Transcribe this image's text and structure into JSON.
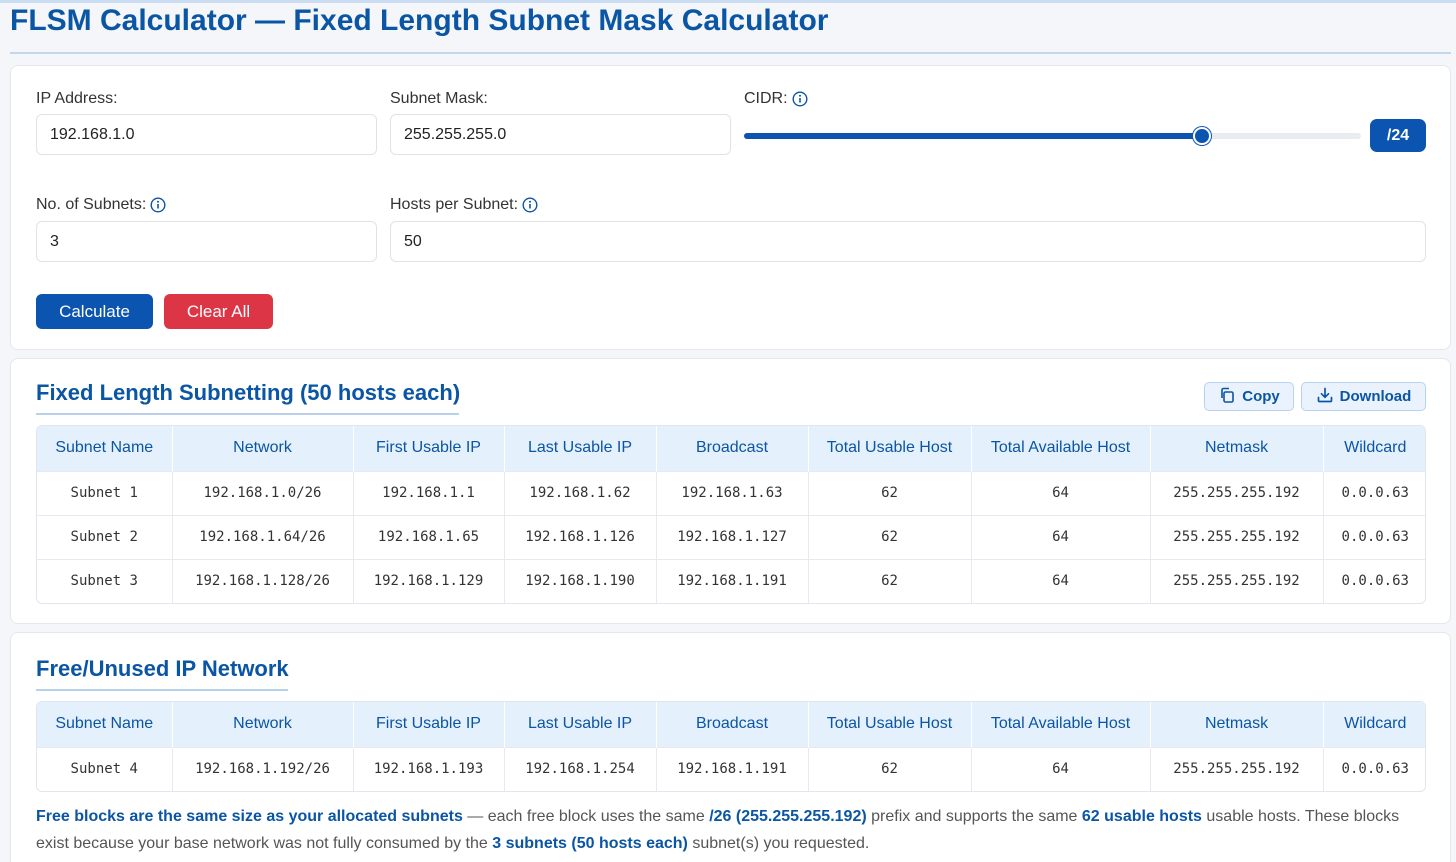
{
  "title": "FLSM Calculator — Fixed Length Subnet Mask Calculator",
  "form": {
    "ip_label": "IP Address:",
    "ip_value": "192.168.1.0",
    "mask_label": "Subnet Mask:",
    "mask_value": "255.255.255.0",
    "cidr_label": "CIDR:",
    "cidr_value": 24,
    "cidr_min": 0,
    "cidr_max": 32,
    "cidr_badge": "/24",
    "subnets_label": "No. of Subnets:",
    "subnets_value": "3",
    "hosts_label": "Hosts per Subnet:",
    "hosts_value": "50",
    "calculate_label": "Calculate",
    "clear_label": "Clear All"
  },
  "fixed": {
    "title": "Fixed Length Subnetting (50 hosts each)",
    "copy_label": "Copy",
    "download_label": "Download",
    "headers": [
      "Subnet Name",
      "Network",
      "First Usable IP",
      "Last Usable IP",
      "Broadcast",
      "Total Usable Host",
      "Total Available Host",
      "Netmask",
      "Wildcard"
    ],
    "rows": [
      [
        "Subnet 1",
        "192.168.1.0/26",
        "192.168.1.1",
        "192.168.1.62",
        "192.168.1.63",
        "62",
        "64",
        "255.255.255.192",
        "0.0.0.63"
      ],
      [
        "Subnet 2",
        "192.168.1.64/26",
        "192.168.1.65",
        "192.168.1.126",
        "192.168.1.127",
        "62",
        "64",
        "255.255.255.192",
        "0.0.0.63"
      ],
      [
        "Subnet 3",
        "192.168.1.128/26",
        "192.168.1.129",
        "192.168.1.190",
        "192.168.1.191",
        "62",
        "64",
        "255.255.255.192",
        "0.0.0.63"
      ]
    ]
  },
  "free": {
    "title": "Free/Unused IP Network",
    "headers": [
      "Subnet Name",
      "Network",
      "First Usable IP",
      "Last Usable IP",
      "Broadcast",
      "Total Usable Host",
      "Total Available Host",
      "Netmask",
      "Wildcard"
    ],
    "rows": [
      [
        "Subnet 4",
        "192.168.1.192/26",
        "192.168.1.193",
        "192.168.1.254",
        "192.168.1.191",
        "62",
        "64",
        "255.255.255.192",
        "0.0.0.63"
      ]
    ],
    "note": {
      "b1": "Free blocks are the same size as your allocated subnets",
      "t1": " — each free block uses the same ",
      "b2": "/26 (255.255.255.192)",
      "t2": " prefix and supports the same ",
      "b3": "62 usable hosts",
      "t3": " usable hosts. These blocks exist because your base network was not fully consumed by the ",
      "b4": "3 subnets (50 hosts each)",
      "t4": " subnet(s) you requested."
    }
  },
  "colors": {
    "primary": "#0b55b0",
    "title": "#0b55a5",
    "danger": "#dc3545",
    "header_bg": "#e4f0fc"
  }
}
